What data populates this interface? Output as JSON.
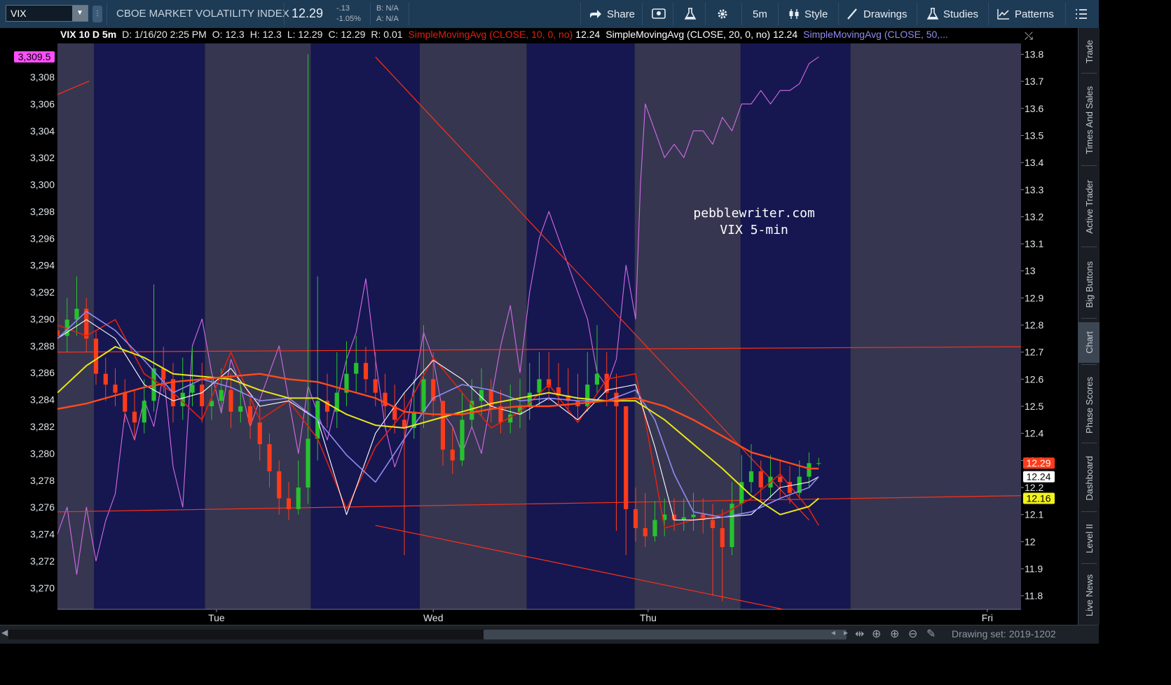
{
  "toolbar": {
    "symbol": "VIX",
    "name": "CBOE MARKET VOLATILITY INDEX",
    "price": "12.29",
    "change": "-.13",
    "change_pct": "-1.05%",
    "bid": "B: N/A",
    "ask": "A: N/A",
    "share": "Share",
    "interval": "5m",
    "style": "Style",
    "drawings": "Drawings",
    "studies": "Studies",
    "patterns": "Patterns"
  },
  "sidebar": [
    "Trade",
    "Times And Sales",
    "Active Trader",
    "Big Buttons",
    "Chart",
    "Phase Scores",
    "Dashboard",
    "Level II",
    "Live News"
  ],
  "sidebar_active": "Chart",
  "bottom": {
    "drawing_set": "Drawing set: 2019-1202"
  },
  "colors": {
    "background": "#000000",
    "bg_band_light": "#363651",
    "bg_band_dark": "#161750",
    "sma10": "#e0200f",
    "sma20": "#ffffff",
    "sma50": "#8f8cf0",
    "sma_long": "#e8e814",
    "sma_long_red": "#ff4a1c",
    "spx": "#d36be6",
    "candle_up": "#26c22e",
    "candle_down": "#ff3b1a",
    "trendline": "#ff3015"
  },
  "chart_data": {
    "type": "candlestick",
    "title": "VIX 10 D 5m",
    "header": {
      "symbol_label": "VIX 10 D 5m",
      "date": "D: 1/16/20 2:25 PM",
      "open": "O: 12.3",
      "high": "H: 12.3",
      "low": "L: 12.29",
      "close": "C: 12.29",
      "range": "R: 0.01",
      "studies": [
        {
          "label": "SimpleMovingAvg (CLOSE, 10, 0, no)",
          "value": "12.24",
          "color": "#e0200f"
        },
        {
          "label": "SimpleMovingAvg (CLOSE, 20, 0, no)",
          "value": "12.24",
          "color": "#ffffff"
        },
        {
          "label": "SimpleMovingAvg (CLOSE, 50,...",
          "value": "",
          "color": "#8f8cf0"
        }
      ]
    },
    "annotation": [
      "pebblewriter.com",
      "VIX 5-min"
    ],
    "x_labels": [
      "Tue",
      "Wed",
      "Thu",
      "Fri"
    ],
    "right_axis": {
      "ticks": [
        "13.8",
        "13.7",
        "13.6",
        "13.5",
        "13.4",
        "13.3",
        "13.2",
        "13.1",
        "13",
        "12.9",
        "12.8",
        "12.7",
        "12.6",
        "12.5",
        "12.4",
        "12.3",
        "12.2",
        "12.1",
        "12",
        "11.9",
        "11.8"
      ],
      "ylim": [
        11.75,
        13.84
      ]
    },
    "left_axis": {
      "ticks": [
        "3,308",
        "3,306",
        "3,304",
        "3,302",
        "3,300",
        "3,298",
        "3,296",
        "3,294",
        "3,292",
        "3,290",
        "3,288",
        "3,286",
        "3,284",
        "3,282",
        "3,280",
        "3,278",
        "3,276",
        "3,274",
        "3,272",
        "3,270"
      ],
      "ylim": [
        3268.4,
        3310.5
      ]
    },
    "price_tags": [
      {
        "label": "12.29",
        "y": 12.29,
        "bg": "#ff3b1a",
        "fg": "#ffffff"
      },
      {
        "label": "12.24",
        "y": 12.24,
        "bg": "#ffffff",
        "fg": "#000000"
      },
      {
        "label": "12.16",
        "y": 12.16,
        "bg": "#f2f21a",
        "fg": "#000000"
      }
    ],
    "left_tag": {
      "label": "3,309.5",
      "y": 3309.5,
      "bg": "#ff4fff",
      "fg": "#000000"
    },
    "x_range": [
      0,
      100
    ],
    "sessions": [
      {
        "x0": 0,
        "x1": 3.8,
        "shade": "light"
      },
      {
        "x0": 3.8,
        "x1": 15.3,
        "shade": "dark"
      },
      {
        "x0": 15.3,
        "x1": 26.3,
        "shade": "light"
      },
      {
        "x0": 26.3,
        "x1": 37.6,
        "shade": "dark"
      },
      {
        "x0": 37.6,
        "x1": 48.7,
        "shade": "light"
      },
      {
        "x0": 48.7,
        "x1": 59.9,
        "shade": "dark"
      },
      {
        "x0": 59.9,
        "x1": 70.9,
        "shade": "light"
      },
      {
        "x0": 70.9,
        "x1": 82.3,
        "shade": "dark"
      },
      {
        "x0": 82.3,
        "x1": 100,
        "shade": "light"
      }
    ],
    "x_label_pos": [
      16.5,
      39.0,
      61.3,
      96.5
    ],
    "series": [
      {
        "name": "SimpleMovingAvg (CLOSE, 10, 0, no)",
        "color": "#e0200f",
        "axis": "right",
        "width": 1.6,
        "x": [
          0,
          3,
          6,
          9,
          12,
          15,
          18,
          21,
          24,
          27,
          30,
          33,
          36,
          39,
          42,
          45,
          48,
          51,
          54,
          57,
          60,
          61,
          63,
          66,
          69,
          72,
          75,
          78,
          79
        ],
        "y": [
          12.8,
          12.76,
          12.82,
          12.62,
          12.55,
          12.45,
          12.7,
          12.45,
          12.52,
          12.38,
          12.12,
          12.35,
          12.48,
          12.68,
          12.55,
          12.42,
          12.48,
          12.58,
          12.44,
          12.6,
          12.62,
          12.45,
          12.05,
          12.08,
          12.1,
          12.16,
          12.25,
          12.12,
          12.06
        ]
      },
      {
        "name": "SimpleMovingAvg (CLOSE, 20, 0, no)",
        "color": "#ffffff",
        "axis": "right",
        "width": 1.1,
        "x": [
          0,
          3,
          6,
          9,
          12,
          15,
          18,
          21,
          24,
          27,
          30,
          33,
          36,
          39,
          42,
          45,
          48,
          51,
          54,
          57,
          60,
          62,
          64,
          66,
          69,
          72,
          75,
          78,
          79
        ],
        "y": [
          12.75,
          12.82,
          12.75,
          12.58,
          12.52,
          12.55,
          12.64,
          12.5,
          12.52,
          12.45,
          12.1,
          12.4,
          12.55,
          12.67,
          12.6,
          12.5,
          12.47,
          12.53,
          12.45,
          12.56,
          12.58,
          12.35,
          12.08,
          12.08,
          12.09,
          12.1,
          12.2,
          12.22,
          12.24
        ]
      },
      {
        "name": "SimpleMovingAvg (CLOSE, 50,...",
        "color": "#8f8cf0",
        "axis": "right",
        "width": 1.6,
        "x": [
          0,
          3,
          6,
          9,
          12,
          15,
          18,
          21,
          24,
          27,
          30,
          33,
          36,
          39,
          42,
          45,
          48,
          51,
          54,
          57,
          60,
          62,
          64,
          66,
          69,
          72,
          75,
          78,
          79
        ],
        "y": [
          12.75,
          12.85,
          12.78,
          12.67,
          12.55,
          12.6,
          12.57,
          12.52,
          12.53,
          12.45,
          12.32,
          12.22,
          12.38,
          12.53,
          12.58,
          12.56,
          12.52,
          12.53,
          12.52,
          12.52,
          12.56,
          12.45,
          12.25,
          12.11,
          12.09,
          12.11,
          12.16,
          12.2,
          12.24
        ]
      },
      {
        "name": "SMA long",
        "color": "#e8e814",
        "axis": "right",
        "width": 2,
        "x": [
          0,
          3,
          6,
          9,
          12,
          15,
          18,
          21,
          24,
          27,
          30,
          33,
          36,
          39,
          42,
          45,
          48,
          51,
          54,
          57,
          60,
          63,
          66,
          69,
          72,
          75,
          78,
          79
        ],
        "y": [
          12.55,
          12.65,
          12.72,
          12.68,
          12.62,
          12.61,
          12.6,
          12.56,
          12.53,
          12.53,
          12.47,
          12.43,
          12.42,
          12.45,
          12.48,
          12.51,
          12.53,
          12.55,
          12.53,
          12.52,
          12.52,
          12.45,
          12.36,
          12.27,
          12.17,
          12.1,
          12.13,
          12.16
        ]
      },
      {
        "name": "SMA long (red)",
        "color": "#ff4a1c",
        "axis": "right",
        "width": 2.4,
        "x": [
          0,
          3,
          6,
          9,
          12,
          15,
          18,
          21,
          24,
          27,
          30,
          33,
          36,
          39,
          42,
          45,
          48,
          51,
          54,
          57,
          60,
          63,
          66,
          69,
          72,
          75,
          78,
          79
        ],
        "y": [
          12.49,
          12.51,
          12.54,
          12.57,
          12.59,
          12.6,
          12.61,
          12.62,
          12.6,
          12.59,
          12.56,
          12.53,
          12.48,
          12.47,
          12.47,
          12.49,
          12.5,
          12.5,
          12.51,
          12.52,
          12.53,
          12.5,
          12.45,
          12.39,
          12.33,
          12.3,
          12.27,
          12.27
        ]
      },
      {
        "name": "SPX",
        "color": "#d36be6",
        "axis": "left",
        "width": 1.1,
        "x": [
          0,
          1,
          2,
          3,
          4,
          5,
          6,
          7,
          8,
          9,
          10,
          11,
          12,
          13,
          14,
          15,
          16,
          17,
          18,
          19,
          20,
          21,
          22,
          23,
          24,
          25,
          26,
          27,
          28,
          29,
          30,
          31,
          32,
          33,
          34,
          35,
          36,
          37,
          38,
          39,
          40,
          41,
          42,
          43,
          44,
          45,
          46,
          47,
          48,
          49,
          50,
          51,
          52,
          53,
          54,
          55,
          56,
          57,
          58,
          59,
          60,
          60.5,
          61,
          62,
          63,
          64,
          65,
          66,
          67,
          68,
          69,
          70,
          71,
          72,
          73,
          74,
          75,
          76,
          77,
          78,
          79
        ],
        "y": [
          3274,
          3276,
          3271,
          3276,
          3272,
          3275,
          3277,
          3283,
          3281,
          3284,
          3282,
          3286,
          3279,
          3276,
          3288,
          3290,
          3286,
          3283,
          3287,
          3285,
          3282,
          3284,
          3286,
          3288,
          3284,
          3280,
          3285,
          3283,
          3281,
          3284,
          3287,
          3289,
          3293,
          3287,
          3282,
          3279,
          3281,
          3285,
          3289,
          3287,
          3283,
          3282,
          3280,
          3282,
          3280,
          3284,
          3288,
          3291,
          3286,
          3292,
          3296,
          3298,
          3296,
          3294,
          3292,
          3290,
          3286,
          3285,
          3287,
          3294,
          3290,
          3300,
          3306,
          3304,
          3302,
          3303,
          3302,
          3304,
          3304,
          3303,
          3305,
          3304,
          3306,
          3306,
          3307,
          3306,
          3307,
          3307,
          3307.5,
          3309,
          3309.5
        ]
      }
    ],
    "candles": {
      "axis": "right",
      "x": [
        0,
        1,
        2,
        3,
        4,
        5,
        6,
        7,
        8,
        9,
        10,
        11,
        12,
        13,
        14,
        15,
        16,
        17,
        18,
        19,
        20,
        21,
        22,
        23,
        24,
        25,
        26,
        27,
        28,
        29,
        30,
        31,
        32,
        33,
        34,
        35,
        36,
        37,
        38,
        39,
        40,
        41,
        42,
        43,
        44,
        45,
        46,
        47,
        48,
        49,
        50,
        51,
        52,
        53,
        54,
        55,
        56,
        57,
        58,
        59,
        60,
        61,
        62,
        63,
        64,
        65,
        66,
        67,
        68,
        69,
        70,
        71,
        72,
        73,
        74,
        75,
        76,
        77,
        78,
        79
      ],
      "open": [
        12.78,
        12.76,
        12.82,
        12.86,
        12.75,
        12.62,
        12.58,
        12.55,
        12.48,
        12.44,
        12.52,
        12.64,
        12.6,
        12.5,
        12.55,
        12.58,
        12.5,
        12.52,
        12.56,
        12.48,
        12.5,
        12.44,
        12.36,
        12.26,
        12.16,
        12.12,
        12.2,
        12.38,
        12.52,
        12.48,
        12.55,
        12.62,
        12.66,
        12.6,
        12.55,
        12.5,
        12.45,
        12.42,
        12.48,
        12.6,
        12.52,
        12.34,
        12.3,
        12.45,
        12.52,
        12.56,
        12.5,
        12.44,
        12.47,
        12.5,
        12.55,
        12.6,
        12.57,
        12.54,
        12.52,
        12.5,
        12.58,
        12.62,
        12.55,
        12.5,
        12.12,
        12.05,
        12.02,
        12.08,
        12.1,
        12.08,
        12.09,
        12.1,
        12.08,
        12.05,
        11.98,
        12.14,
        12.22,
        12.26,
        12.2,
        12.24,
        12.22,
        12.18,
        12.24,
        12.29
      ],
      "close": [
        12.76,
        12.82,
        12.86,
        12.75,
        12.62,
        12.58,
        12.55,
        12.48,
        12.44,
        12.52,
        12.64,
        12.6,
        12.5,
        12.55,
        12.58,
        12.5,
        12.52,
        12.56,
        12.48,
        12.5,
        12.44,
        12.36,
        12.26,
        12.16,
        12.12,
        12.2,
        12.38,
        12.52,
        12.48,
        12.55,
        12.62,
        12.66,
        12.6,
        12.55,
        12.5,
        12.45,
        12.42,
        12.48,
        12.6,
        12.52,
        12.34,
        12.3,
        12.45,
        12.52,
        12.56,
        12.5,
        12.44,
        12.47,
        12.5,
        12.55,
        12.6,
        12.57,
        12.54,
        12.52,
        12.5,
        12.58,
        12.62,
        12.55,
        12.5,
        12.12,
        12.05,
        12.02,
        12.08,
        12.1,
        12.08,
        12.09,
        12.1,
        12.08,
        12.05,
        11.98,
        12.14,
        12.22,
        12.26,
        12.2,
        12.24,
        12.22,
        12.18,
        12.24,
        12.29,
        12.29
      ],
      "high": [
        12.85,
        12.9,
        12.98,
        12.9,
        12.78,
        12.68,
        12.64,
        12.6,
        12.56,
        12.6,
        12.95,
        12.72,
        12.66,
        12.68,
        12.72,
        12.66,
        12.6,
        12.64,
        12.62,
        12.58,
        12.54,
        12.5,
        12.4,
        12.3,
        12.22,
        12.3,
        13.8,
        12.98,
        12.62,
        12.7,
        12.74,
        12.76,
        12.72,
        12.7,
        12.62,
        12.58,
        12.55,
        12.6,
        12.8,
        12.7,
        12.5,
        12.42,
        12.55,
        12.6,
        12.64,
        12.6,
        12.56,
        12.58,
        12.6,
        12.66,
        12.7,
        12.7,
        12.66,
        12.64,
        12.62,
        12.7,
        12.8,
        12.7,
        12.62,
        12.3,
        12.2,
        12.18,
        12.15,
        12.16,
        12.16,
        12.16,
        12.18,
        12.16,
        12.14,
        12.12,
        12.22,
        12.32,
        12.36,
        12.3,
        12.32,
        12.3,
        12.28,
        12.3,
        12.33,
        12.31
      ],
      "low": [
        12.7,
        12.7,
        12.76,
        12.7,
        12.58,
        12.52,
        12.5,
        12.44,
        12.38,
        12.4,
        12.48,
        12.55,
        12.44,
        12.45,
        12.5,
        12.44,
        12.45,
        12.48,
        12.42,
        12.44,
        12.38,
        12.3,
        12.2,
        12.1,
        12.08,
        12.1,
        12.14,
        12.3,
        12.42,
        12.42,
        12.5,
        12.55,
        12.55,
        12.5,
        12.46,
        12.4,
        11.95,
        12.38,
        12.42,
        12.46,
        12.28,
        12.25,
        12.28,
        12.42,
        12.46,
        12.44,
        12.4,
        12.4,
        12.42,
        12.45,
        12.5,
        12.52,
        12.5,
        12.48,
        12.45,
        12.48,
        12.55,
        12.5,
        12.04,
        11.95,
        12.0,
        11.98,
        12.0,
        12.02,
        12.04,
        12.04,
        12.04,
        12.03,
        11.8,
        11.78,
        11.95,
        12.1,
        12.18,
        12.15,
        12.16,
        12.16,
        12.14,
        12.16,
        12.2,
        12.28
      ]
    },
    "trendlines": [
      {
        "axis": "right",
        "x0": 0,
        "y0": 12.7,
        "x1": 100,
        "y1": 12.72
      },
      {
        "axis": "right",
        "x0": 0,
        "y0": 12.11,
        "x1": 100,
        "y1": 12.17
      },
      {
        "axis": "right",
        "x0": 33,
        "y0": 12.06,
        "x1": 75.3,
        "y1": 11.75
      },
      {
        "axis": "right",
        "x0": 33,
        "y0": 13.79,
        "x1": 78,
        "y1": 12.08
      },
      {
        "axis": "left",
        "x0": 0,
        "y0": 3306.7,
        "x1": 3.3,
        "y1": 3307.7
      }
    ]
  }
}
